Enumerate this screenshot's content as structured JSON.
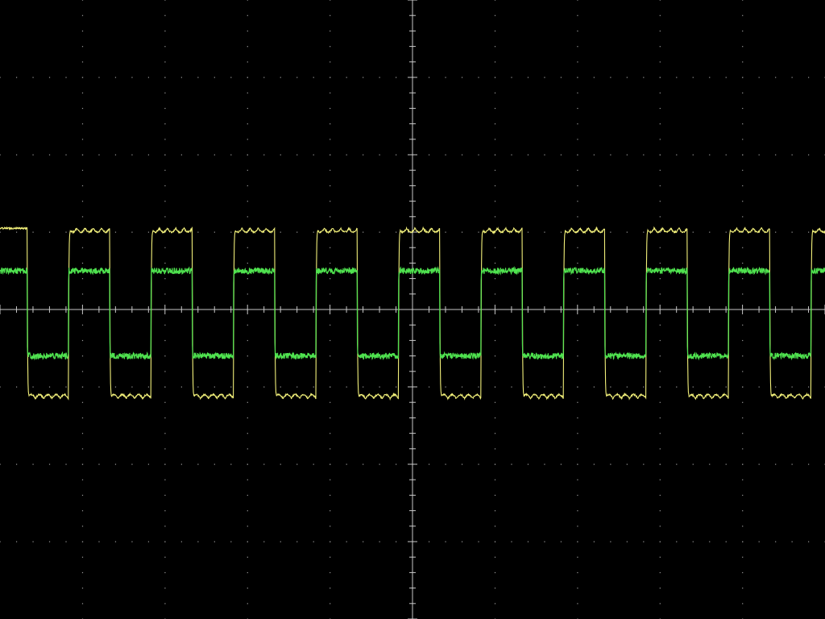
{
  "colors": {
    "background": "#000000",
    "graticule": "#9a9a9a",
    "channel_1": "#f2f07a",
    "channel_2": "#4fe24f"
  },
  "chart_data": {
    "type": "line",
    "xlabel": "",
    "ylabel": "",
    "xlim": [
      -5,
      5
    ],
    "ylim": [
      -4,
      4
    ],
    "grid": true,
    "legend": "none",
    "x_divisions": 10,
    "y_divisions": 8,
    "series": [
      {
        "color": "#f2f07a",
        "waveform": "square",
        "high": 1.05,
        "low": -1.15,
        "period": 1.0,
        "first_fall": -4.67,
        "duty": 0.5,
        "rise_time": 0.02,
        "ripple": 0.05,
        "edges": [
          -4.67,
          -4.17,
          -3.67,
          -3.17,
          -2.67,
          -2.17,
          -1.67,
          -1.17,
          -0.67,
          -0.17,
          0.33,
          0.83,
          1.33,
          1.83,
          2.33,
          2.83,
          3.33,
          3.83,
          4.33,
          4.83
        ]
      },
      {
        "color": "#4fe24f",
        "waveform": "square",
        "high": 0.5,
        "low": -0.6,
        "period": 1.0,
        "first_fall": -4.67,
        "duty": 0.5,
        "rise_time": 0.005,
        "noise": 0.04,
        "edges": [
          -4.67,
          -4.17,
          -3.67,
          -3.17,
          -2.67,
          -2.17,
          -1.67,
          -1.17,
          -0.67,
          -0.17,
          0.33,
          0.83,
          1.33,
          1.83,
          2.33,
          2.83,
          3.33,
          3.83,
          4.33,
          4.83
        ]
      }
    ]
  }
}
